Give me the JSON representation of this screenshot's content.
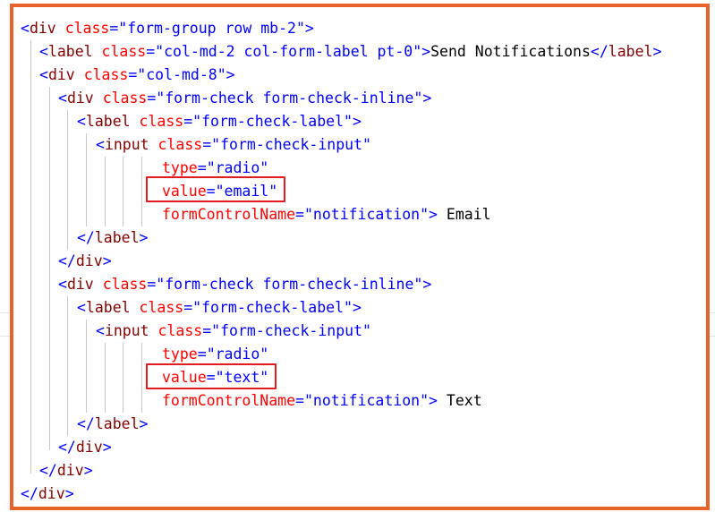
{
  "code": {
    "lines": [
      [
        {
          "t": "<",
          "c": "br"
        },
        {
          "t": "div",
          "c": "tag"
        },
        {
          "t": " ",
          "c": "tx"
        },
        {
          "t": "class",
          "c": "at"
        },
        {
          "t": "=",
          "c": "br"
        },
        {
          "t": "\"form-group row mb-2\"",
          "c": "st"
        },
        {
          "t": ">",
          "c": "br"
        }
      ],
      [
        {
          "t": "<",
          "c": "br"
        },
        {
          "t": "label",
          "c": "tag"
        },
        {
          "t": " ",
          "c": "tx"
        },
        {
          "t": "class",
          "c": "at"
        },
        {
          "t": "=",
          "c": "br"
        },
        {
          "t": "\"col-md-2 col-form-label pt-0\"",
          "c": "st"
        },
        {
          "t": ">",
          "c": "br"
        },
        {
          "t": "Send Notifications",
          "c": "tx"
        },
        {
          "t": "</",
          "c": "br"
        },
        {
          "t": "label",
          "c": "tag"
        },
        {
          "t": ">",
          "c": "br"
        }
      ],
      [
        {
          "t": "<",
          "c": "br"
        },
        {
          "t": "div",
          "c": "tag"
        },
        {
          "t": " ",
          "c": "tx"
        },
        {
          "t": "class",
          "c": "at"
        },
        {
          "t": "=",
          "c": "br"
        },
        {
          "t": "\"col-md-8\"",
          "c": "st"
        },
        {
          "t": ">",
          "c": "br"
        }
      ],
      [
        {
          "t": "<",
          "c": "br"
        },
        {
          "t": "div",
          "c": "tag"
        },
        {
          "t": " ",
          "c": "tx"
        },
        {
          "t": "class",
          "c": "at"
        },
        {
          "t": "=",
          "c": "br"
        },
        {
          "t": "\"form-check form-check-inline\"",
          "c": "st"
        },
        {
          "t": ">",
          "c": "br"
        }
      ],
      [
        {
          "t": "<",
          "c": "br"
        },
        {
          "t": "label",
          "c": "tag"
        },
        {
          "t": " ",
          "c": "tx"
        },
        {
          "t": "class",
          "c": "at"
        },
        {
          "t": "=",
          "c": "br"
        },
        {
          "t": "\"form-check-label\"",
          "c": "st"
        },
        {
          "t": ">",
          "c": "br"
        }
      ],
      [
        {
          "t": "<",
          "c": "br"
        },
        {
          "t": "input",
          "c": "tag"
        },
        {
          "t": " ",
          "c": "tx"
        },
        {
          "t": "class",
          "c": "at"
        },
        {
          "t": "=",
          "c": "br"
        },
        {
          "t": "\"form-check-input\"",
          "c": "st"
        }
      ],
      [
        {
          "t": "type",
          "c": "at"
        },
        {
          "t": "=",
          "c": "br"
        },
        {
          "t": "\"radio\"",
          "c": "st"
        }
      ],
      [
        {
          "t": "value",
          "c": "at"
        },
        {
          "t": "=",
          "c": "br"
        },
        {
          "t": "\"email\"",
          "c": "st"
        }
      ],
      [
        {
          "t": "formControlName",
          "c": "at"
        },
        {
          "t": "=",
          "c": "br"
        },
        {
          "t": "\"notification\"",
          "c": "st"
        },
        {
          "t": ">",
          "c": "br"
        },
        {
          "t": " Email",
          "c": "tx"
        }
      ],
      [
        {
          "t": "</",
          "c": "br"
        },
        {
          "t": "label",
          "c": "tag"
        },
        {
          "t": ">",
          "c": "br"
        }
      ],
      [
        {
          "t": "</",
          "c": "br"
        },
        {
          "t": "div",
          "c": "tag"
        },
        {
          "t": ">",
          "c": "br"
        }
      ],
      [
        {
          "t": "<",
          "c": "br"
        },
        {
          "t": "div",
          "c": "tag"
        },
        {
          "t": " ",
          "c": "tx"
        },
        {
          "t": "class",
          "c": "at"
        },
        {
          "t": "=",
          "c": "br"
        },
        {
          "t": "\"form-check form-check-inline\"",
          "c": "st"
        },
        {
          "t": ">",
          "c": "br"
        }
      ],
      [
        {
          "t": "<",
          "c": "br"
        },
        {
          "t": "label",
          "c": "tag"
        },
        {
          "t": " ",
          "c": "tx"
        },
        {
          "t": "class",
          "c": "at"
        },
        {
          "t": "=",
          "c": "br"
        },
        {
          "t": "\"form-check-label\"",
          "c": "st"
        },
        {
          "t": ">",
          "c": "br"
        }
      ],
      [
        {
          "t": "<",
          "c": "br"
        },
        {
          "t": "input",
          "c": "tag"
        },
        {
          "t": " ",
          "c": "tx"
        },
        {
          "t": "class",
          "c": "at"
        },
        {
          "t": "=",
          "c": "br"
        },
        {
          "t": "\"form-check-input\"",
          "c": "st"
        }
      ],
      [
        {
          "t": "type",
          "c": "at"
        },
        {
          "t": "=",
          "c": "br"
        },
        {
          "t": "\"radio\"",
          "c": "st"
        }
      ],
      [
        {
          "t": "value",
          "c": "at"
        },
        {
          "t": "=",
          "c": "br"
        },
        {
          "t": "\"text\"",
          "c": "st"
        }
      ],
      [
        {
          "t": "formControlName",
          "c": "at"
        },
        {
          "t": "=",
          "c": "br"
        },
        {
          "t": "\"notification\"",
          "c": "st"
        },
        {
          "t": ">",
          "c": "br"
        },
        {
          "t": " Text",
          "c": "tx"
        }
      ],
      [
        {
          "t": "</",
          "c": "br"
        },
        {
          "t": "label",
          "c": "tag"
        },
        {
          "t": ">",
          "c": "br"
        }
      ],
      [
        {
          "t": "</",
          "c": "br"
        },
        {
          "t": "div",
          "c": "tag"
        },
        {
          "t": ">",
          "c": "br"
        }
      ],
      [
        {
          "t": "</",
          "c": "br"
        },
        {
          "t": "div",
          "c": "tag"
        },
        {
          "t": ">",
          "c": "br"
        }
      ],
      [
        {
          "t": "</",
          "c": "br"
        },
        {
          "t": "div",
          "c": "tag"
        },
        {
          "t": ">",
          "c": "br"
        }
      ]
    ]
  },
  "colors": {
    "frame_border": "#e8622e",
    "highlight_border": "#e11b22",
    "tag": "#800000",
    "attribute": "#ff0000",
    "string": "#0000ff",
    "punctuation": "#0000ff",
    "text": "#000000"
  }
}
